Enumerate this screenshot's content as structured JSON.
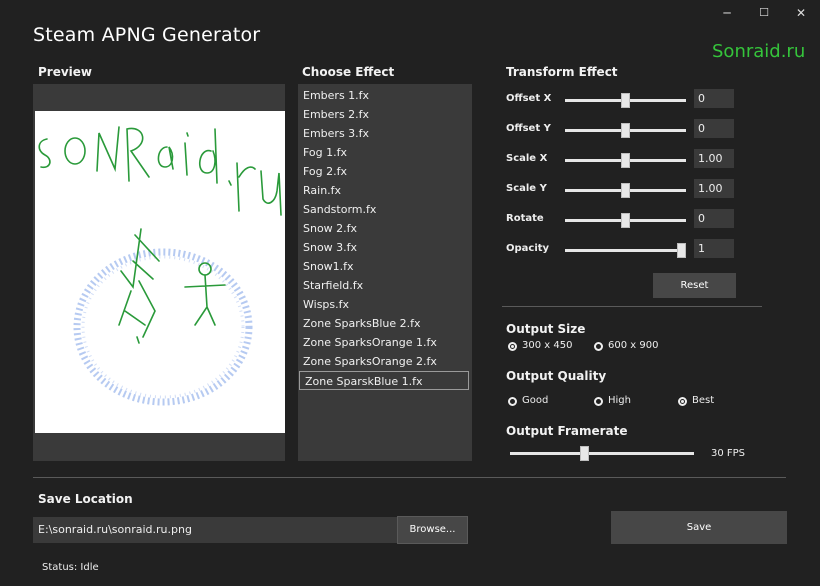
{
  "app": {
    "title": "Steam APNG Generator",
    "watermark": "Sonraid.ru"
  },
  "window_controls": {
    "minimize": "─",
    "maximize": "☐",
    "close": "✕"
  },
  "preview": {
    "heading": "Preview"
  },
  "effects": {
    "heading": "Choose Effect",
    "items": [
      "Embers 1.fx",
      "Embers 2.fx",
      "Embers 3.fx",
      "Fog 1.fx",
      "Fog 2.fx",
      "Rain.fx",
      "Sandstorm.fx",
      "Snow 2.fx",
      "Snow 3.fx",
      "Snow1.fx",
      "Starfield.fx",
      "Wisps.fx",
      "Zone SparksBlue 2.fx",
      "Zone SparksOrange 1.fx",
      "Zone SparksOrange 2.fx",
      "Zone SparskBlue 1.fx"
    ],
    "selected_index": 15
  },
  "transform": {
    "heading": "Transform Effect",
    "rows": [
      {
        "label": "Offset X",
        "value": "0",
        "fraction": 0.5
      },
      {
        "label": "Offset Y",
        "value": "0",
        "fraction": 0.5
      },
      {
        "label": "Scale X",
        "value": "1.00",
        "fraction": 0.5
      },
      {
        "label": "Scale Y",
        "value": "1.00",
        "fraction": 0.5
      },
      {
        "label": "Rotate",
        "value": "0",
        "fraction": 0.5
      },
      {
        "label": "Opacity",
        "value": "1",
        "fraction": 1.0
      }
    ],
    "reset_label": "Reset"
  },
  "output_size": {
    "heading": "Output Size",
    "options": [
      "300 x 450",
      "600 x 900"
    ],
    "selected": 0
  },
  "output_quality": {
    "heading": "Output Quality",
    "options": [
      "Good",
      "High",
      "Best"
    ],
    "selected": 2
  },
  "output_framerate": {
    "heading": "Output Framerate",
    "value_label": "30 FPS",
    "fraction": 0.4
  },
  "save": {
    "heading": "Save Location",
    "path": "E:\\sonraid.ru\\sonraid.ru.png",
    "browse_label": "Browse...",
    "save_label": "Save"
  },
  "status": {
    "text": "Status: Idle"
  },
  "colors": {
    "background": "#212121",
    "panel": "#3a3a3a",
    "button": "#474747",
    "watermark": "#35c43b",
    "drawing": "#2a9a3a",
    "ring": "#9bb6e8"
  }
}
